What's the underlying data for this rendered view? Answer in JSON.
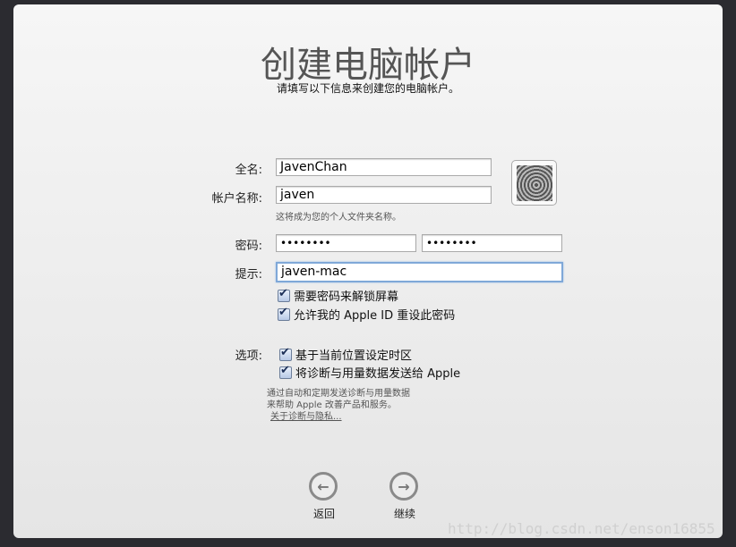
{
  "title": "创建电脑帐户",
  "subtitle": "请填写以下信息来创建您的电脑帐户。",
  "form": {
    "full_name_label": "全名:",
    "full_name": "JavenChan",
    "account_label": "帐户名称:",
    "account": "javen",
    "account_hint": "这将成为您的个人文件夹名称。",
    "password_label": "密码:",
    "password": "••••••••",
    "password_verify": "••••••••",
    "hint_label": "提示:",
    "hint": "javen-mac",
    "require_password": "需要密码来解锁屏幕",
    "allow_appleid_reset": "允许我的 Apple ID 重设此密码"
  },
  "options": {
    "label": "选项:",
    "timezone": "基于当前位置设定时区",
    "send_diagnostics": "将诊断与用量数据发送给 Apple",
    "description_1": "通过自动和定期发送诊断与用量数据",
    "description_2": "来帮助 Apple 改善产品和服务。",
    "privacy_link": "关于诊断与隐私..."
  },
  "nav": {
    "back": "返回",
    "continue": "继续"
  },
  "watermark": "http://blog.csdn.net/enson16855"
}
